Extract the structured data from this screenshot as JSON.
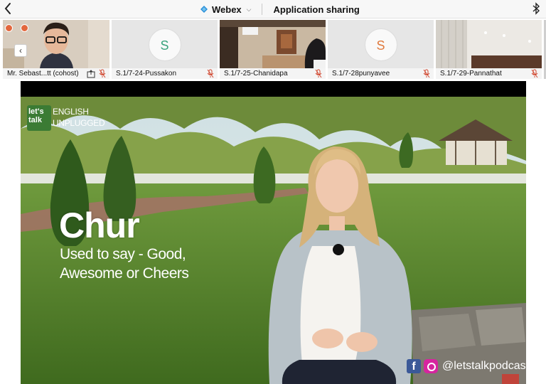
{
  "topbar": {
    "app_name": "Webex",
    "section": "Application sharing"
  },
  "participants": [
    {
      "name": "Mr. Sebast...tt (cohost)",
      "type": "video"
    },
    {
      "name": "S.1/7-24-Pussakon",
      "type": "avatar",
      "initial": "S"
    },
    {
      "name": "S.1/7-25-Chanidapa",
      "type": "video"
    },
    {
      "name": "S.1/7-28punyavee",
      "type": "avatar",
      "initial": "S"
    },
    {
      "name": "S.1/7-29-Pannathat",
      "type": "video"
    }
  ],
  "shared_content": {
    "logo_box": "let's talk",
    "logo_line1": "ENGLISH",
    "logo_line2": "UNPLUGGED",
    "word": "Chur",
    "meaning": "Used to say - Good, Awesome or Cheers",
    "social_handle": "@letstalkpodcast",
    "facebook_glyph": "f"
  },
  "colors": {
    "avatar_green": "#3aa37d",
    "avatar_orange": "#e07a3e",
    "logo_green": "#3b7b34",
    "facebook_blue": "#3b5998",
    "instagram": "#d6249f"
  }
}
